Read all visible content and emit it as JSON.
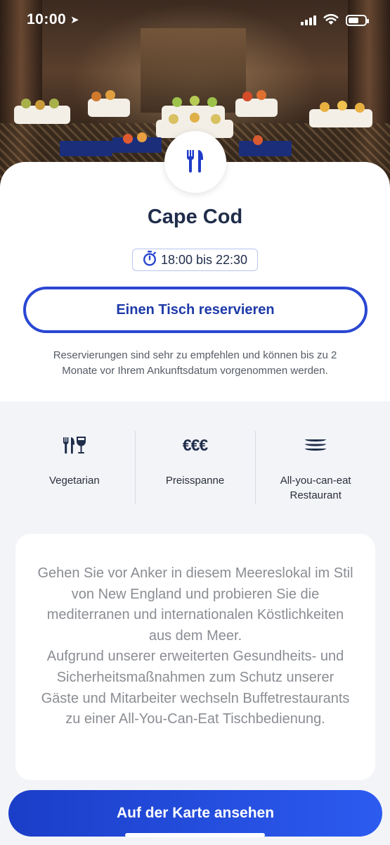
{
  "status_bar": {
    "time": "10:00"
  },
  "restaurant": {
    "name": "Cape Cod",
    "hours": "18:00 bis 22:30"
  },
  "reserve": {
    "label": "Einen Tisch reservieren",
    "note": "Reservierungen sind sehr zu empfehlen und können bis zu 2 Monate vor Ihrem Ankunftsdatum vorgenommen werden."
  },
  "features": [
    {
      "icon": "vegetarian-icon",
      "label": "Vegetarian"
    },
    {
      "icon": "price-icon",
      "glyph": "€€€",
      "label": "Preisspanne"
    },
    {
      "icon": "all-you-can-eat-icon",
      "label": "All-you-can-eat Restaurant"
    }
  ],
  "description": {
    "p1": "Gehen Sie vor Anker in diesem Meereslokal im Stil von New England und probieren Sie die mediterranen und internationalen Köstlichkeiten aus dem Meer.",
    "p2": "Aufgrund unserer erweiterten Gesundheits- und Sicherheitsmaßnahmen zum Schutz unserer Gäste und Mitarbeiter wechseln Buffetrestaurants zu einer All-You-Can-Eat Tischbedienung."
  },
  "map_button": {
    "label": "Auf der Karte ansehen"
  },
  "colors": {
    "accent": "#2a47d2",
    "title": "#1f2d4a",
    "button_gradient_start": "#1b3ec8",
    "button_gradient_end": "#2c5bf0"
  }
}
